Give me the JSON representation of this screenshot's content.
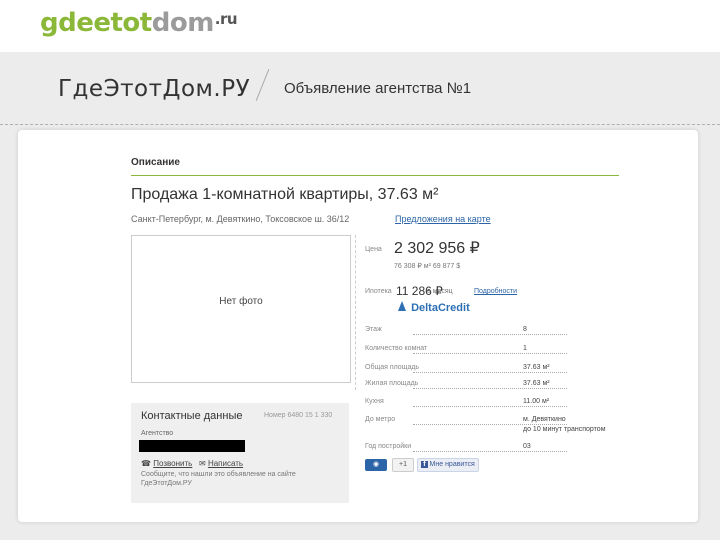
{
  "logo": {
    "part1": "gdeetot",
    "part2": "dom",
    "suffix": ".ru"
  },
  "header": {
    "title": "ГдеЭтотДом.РУ",
    "subtitle": "Объявление агентства №1"
  },
  "tab": "Описание",
  "listing": {
    "title": "Продажа 1-комнатной квартиры, 37.63 м²",
    "address": "Санкт-Петербург, м. Девяткино, Токсовское ш. 36/12",
    "address_link": "Предложения на карте",
    "no_photo": "Нет фото",
    "price_label": "Цена",
    "price": "2 302 956 ₽",
    "price_per_m": "76 308 ₽ м² 69 877 $",
    "mortgage_label": "Ипотека",
    "mortgage_value": "11 286 ₽",
    "mortgage_small": "в месяц",
    "mortgage_link": "Подробности",
    "bank": "DeltaCredit"
  },
  "details": [
    {
      "label": "Этаж",
      "value": "8"
    },
    {
      "label": "Количество комнат",
      "value": "1"
    },
    {
      "label": "Общая площадь",
      "value": "37.63 м²"
    },
    {
      "label": "Жилая площадь",
      "value": "37.63 м²"
    },
    {
      "label": "Кухня",
      "value": "11.00 м²"
    },
    {
      "label": "До метро",
      "value": "м. Девяткино"
    },
    {
      "label": "",
      "value": "до 10 минут транспортом"
    },
    {
      "label": "Год постройки",
      "value": "03"
    }
  ],
  "social": {
    "share": "0",
    "plus": "+1",
    "like": "Мне нравится"
  },
  "contacts": {
    "title": "Контактные данные",
    "listing_id": "Номер 6480 15 1 330",
    "agent_label": "Агентство",
    "button_phone": "Позвонить",
    "button_write": "Написать",
    "note": "Сообщите, что нашли это объявление на сайте ГдеЭтотДом.РУ"
  },
  "colors": {
    "accent_green": "#8cb83a",
    "link_blue": "#2b64a7"
  }
}
